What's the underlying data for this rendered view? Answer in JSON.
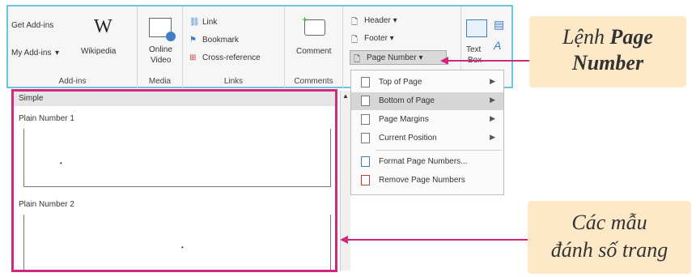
{
  "ribbon": {
    "add_ins": {
      "get": "Get Add-ins",
      "my": "My Add-ins",
      "wiki_letter": "W",
      "wikipedia": "Wikipedia",
      "group": "Add-ins"
    },
    "media": {
      "online_video_1": "Online",
      "online_video_2": "Video",
      "group": "Media"
    },
    "links": {
      "link": "Link",
      "bookmark": "Bookmark",
      "cross_reference": "Cross-reference",
      "group": "Links"
    },
    "comments": {
      "comment": "Comment",
      "group": "Comments"
    },
    "header_footer": {
      "header": "Header",
      "footer": "Footer",
      "page_number": "Page Number"
    },
    "text": {
      "text_box_1": "Text",
      "text_box_2": "Box"
    }
  },
  "gallery": {
    "section_header": "Simple",
    "items": [
      {
        "label": "Plain Number 1"
      },
      {
        "label": "Plain Number 2"
      }
    ]
  },
  "menu": {
    "items": [
      {
        "label": "Top of Page",
        "submenu": true
      },
      {
        "label": "Bottom of Page",
        "submenu": true
      },
      {
        "label": "Page Margins",
        "submenu": true
      },
      {
        "label": "Current Position",
        "submenu": true
      },
      {
        "label": "Format Page Numbers...",
        "submenu": false
      },
      {
        "label": "Remove Page Numbers",
        "submenu": false
      }
    ]
  },
  "captions": {
    "top_line1_prefix": "Lệnh ",
    "top_line1_bold": "Page",
    "top_line2": "Number",
    "bottom_line1": "Các mẫu",
    "bottom_line2": "đánh số trang"
  },
  "colors": {
    "accent_magenta": "#d0287e",
    "ribbon_border": "#6ec2dc",
    "caption_bg": "#fde9c8"
  }
}
